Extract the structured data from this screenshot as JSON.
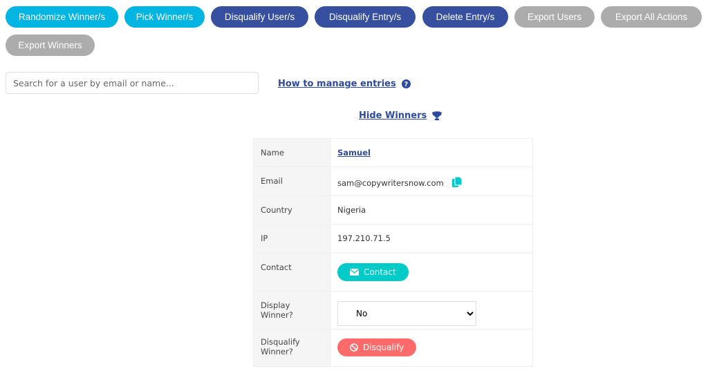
{
  "toolbar": {
    "buttons": [
      "Randomize Winner/s",
      "Pick Winner/s",
      "Disqualify User/s",
      "Disqualify Entry/s",
      "Delete Entry/s",
      "Export Users",
      "Export All Actions",
      "Export Winners"
    ]
  },
  "search": {
    "placeholder": "Search for a user by email or name..."
  },
  "links": {
    "manage": "How to manage entries",
    "hide_winners": "Hide Winners"
  },
  "details": {
    "name_label": "Name",
    "name": "Samuel",
    "email_label": "Email",
    "email": "sam@copywritersnow.com",
    "country_label": "Country",
    "country": "Nigeria",
    "ip_label": "IP",
    "ip": "197.210.71.5",
    "contact_label": "Contact",
    "contact_button": "Contact",
    "display_label": "Display Winner?",
    "display_value": "No",
    "disqualify_label": "Disqualify Winner?",
    "disqualify_button": "Disqualify"
  },
  "colors": {
    "cyan": "#00b5e2",
    "navy": "#36509f",
    "grey": "#acacac",
    "teal": "#00cbc8",
    "red": "#ff6b6b"
  }
}
